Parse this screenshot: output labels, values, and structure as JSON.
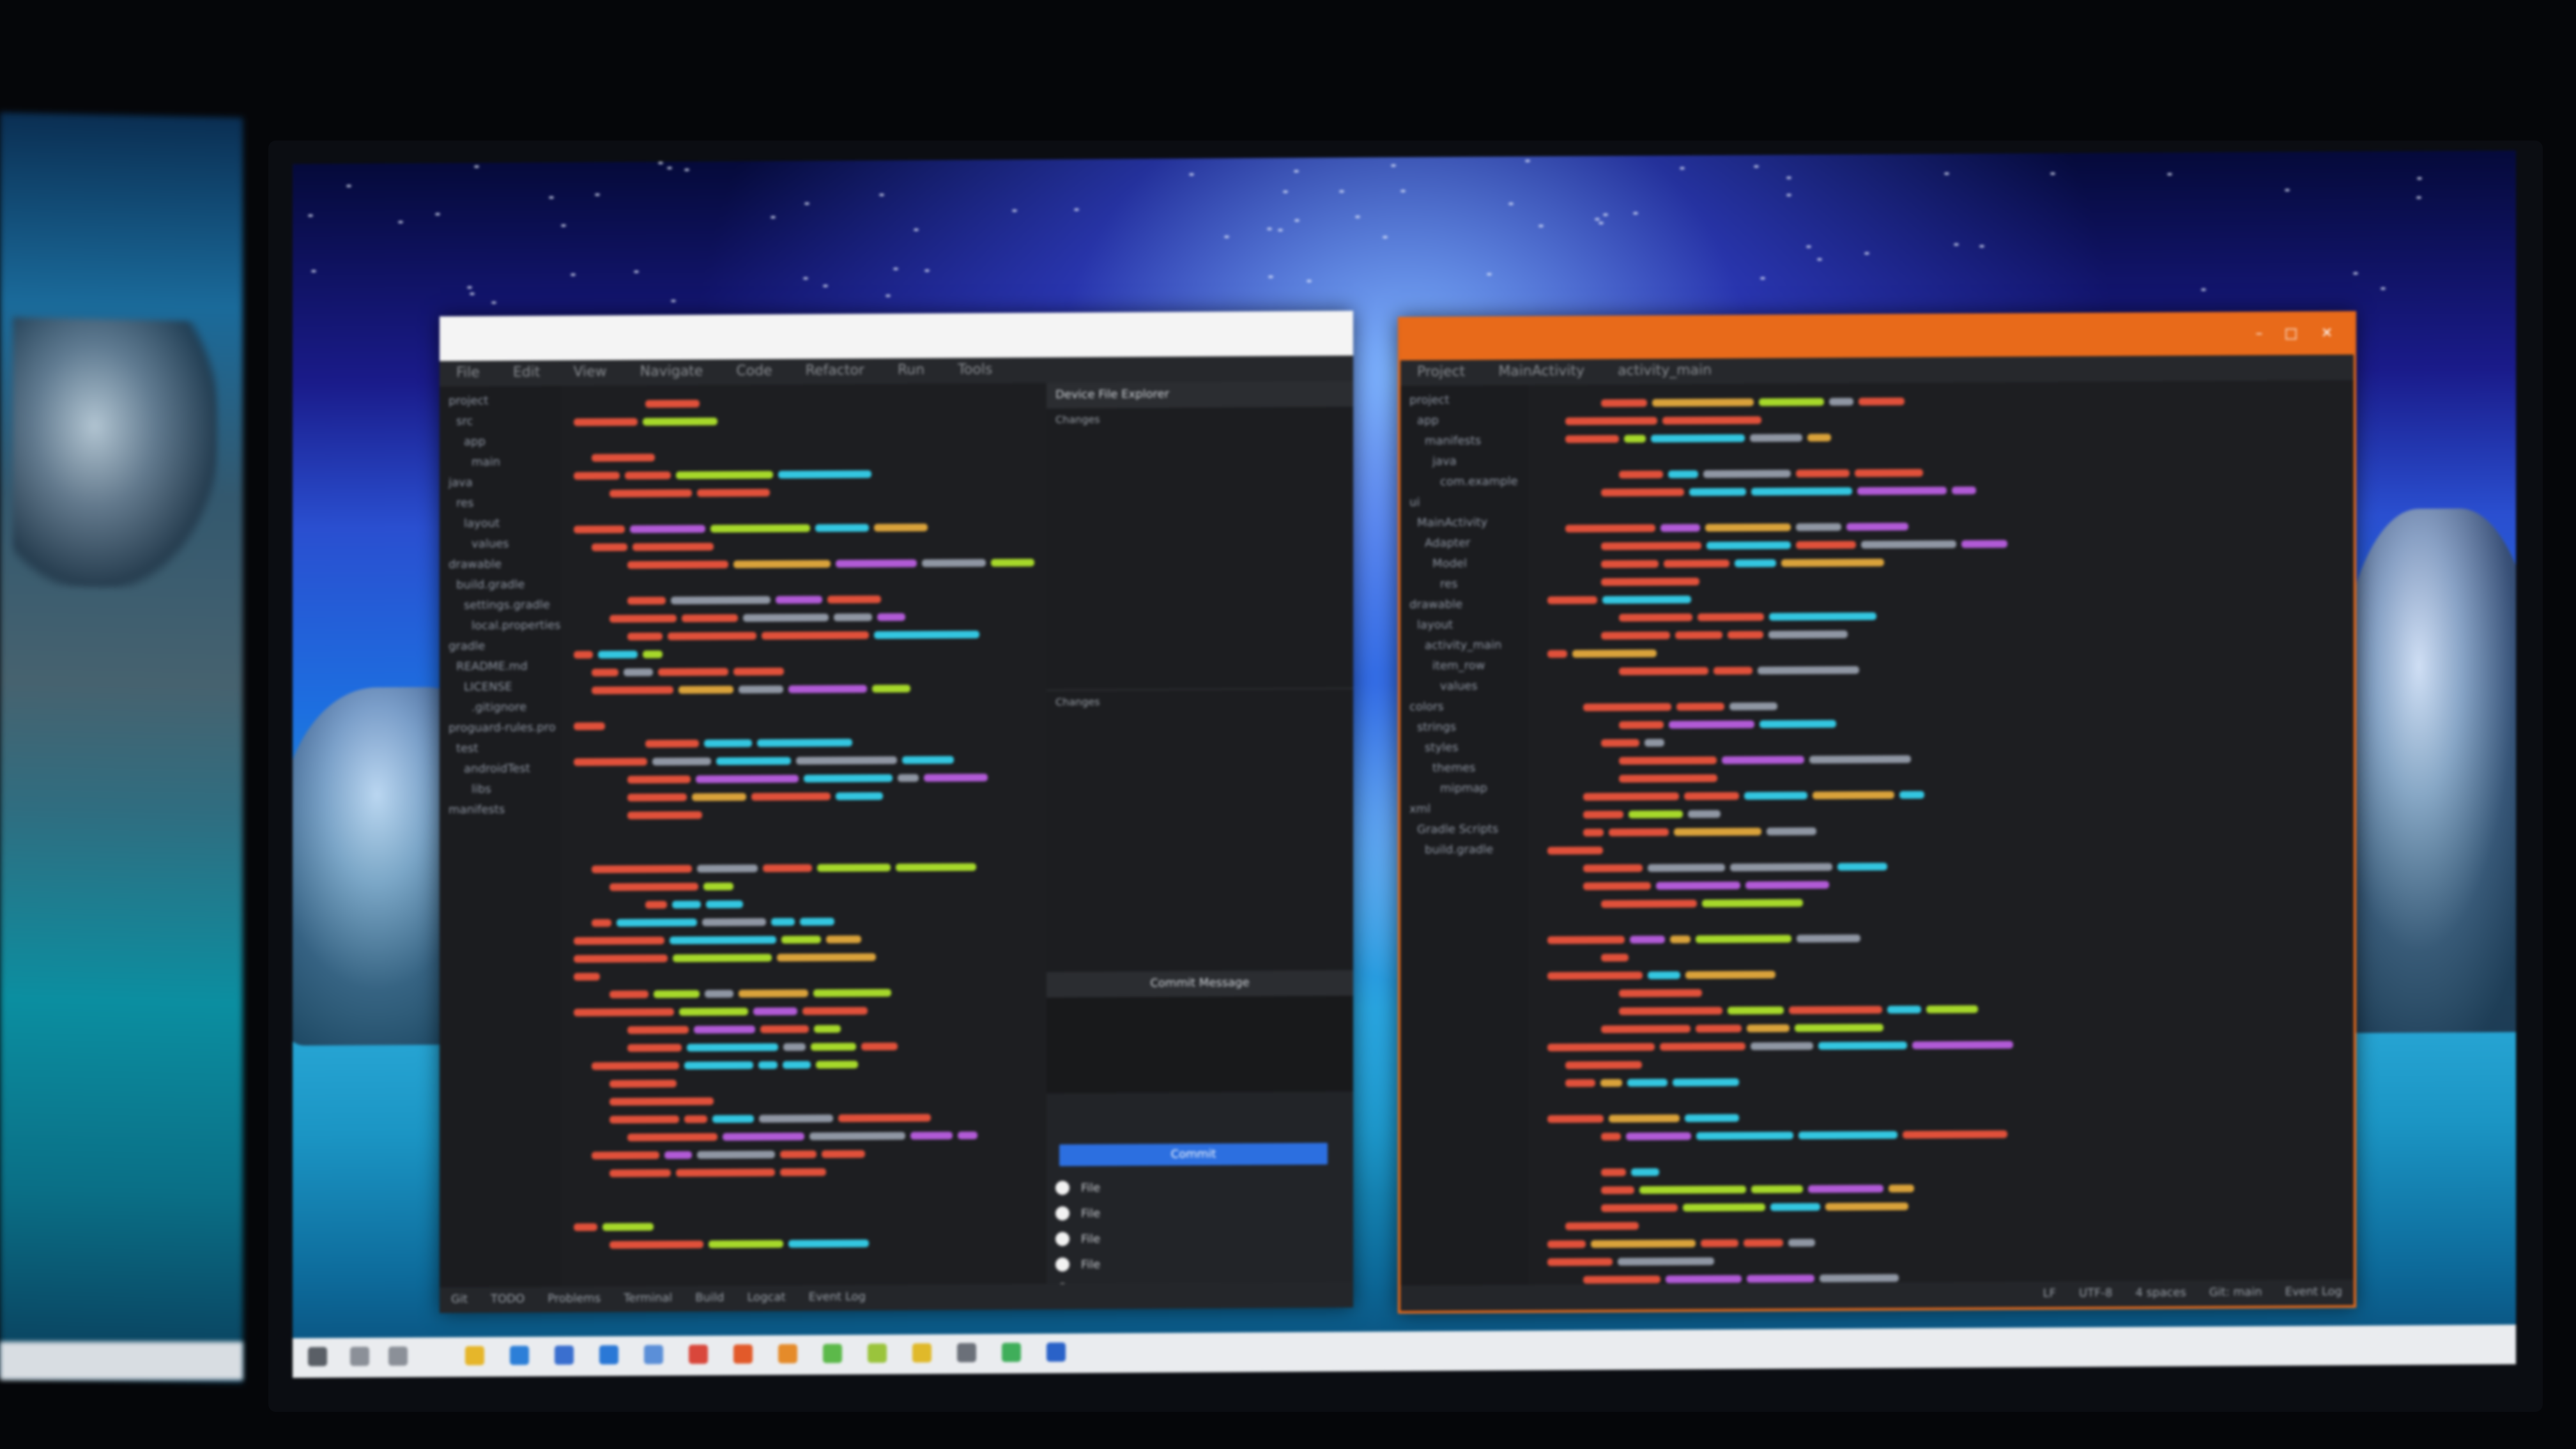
{
  "left_window": {
    "title": "",
    "menu": [
      "File",
      "Edit",
      "View",
      "Navigate",
      "Code",
      "Refactor",
      "Run",
      "Tools"
    ],
    "tree_items": [
      "project",
      "src",
      "app",
      "main",
      "java",
      "res",
      "layout",
      "values",
      "drawable",
      "build.gradle",
      "settings.gradle",
      "local.properties",
      "gradle",
      "README.md",
      "LICENSE",
      ".gitignore",
      "proguard-rules.pro",
      "test",
      "androidTest",
      "libs",
      "manifests"
    ],
    "panel": {
      "top_header": "Device File Explorer",
      "section1": "Changes",
      "section2": "Changes",
      "bottom_header": "Commit Message",
      "commit_button": "Commit",
      "files": [
        "File",
        "File",
        "File",
        "File",
        "File"
      ]
    },
    "status": [
      "Git",
      "TODO",
      "Problems",
      "Terminal",
      "Build",
      "Logcat",
      "Event Log"
    ]
  },
  "right_window": {
    "title": "",
    "tabs": [
      "Project",
      "MainActivity",
      "activity_main"
    ],
    "tree_items": [
      "project",
      "app",
      "manifests",
      "java",
      "com.example",
      "ui",
      "MainActivity",
      "Adapter",
      "Model",
      "res",
      "drawable",
      "layout",
      "activity_main",
      "item_row",
      "values",
      "colors",
      "strings",
      "styles",
      "themes",
      "mipmap",
      "xml",
      "Gradle Scripts",
      "build.gradle"
    ],
    "status": [
      "LF",
      "UTF-8",
      "4 spaces",
      "Git: main",
      "Event Log"
    ]
  },
  "colors": {
    "accent_orange": "#e86a1a",
    "editor_bg": "#1d1e21",
    "token_red": "#e0503a",
    "token_green": "#a6d82a",
    "token_cyan": "#33c6e0",
    "token_purple": "#b15ad6",
    "commit_blue": "#2c6fe0"
  },
  "taskbar": {
    "clock_time": "",
    "clock_date": ""
  }
}
